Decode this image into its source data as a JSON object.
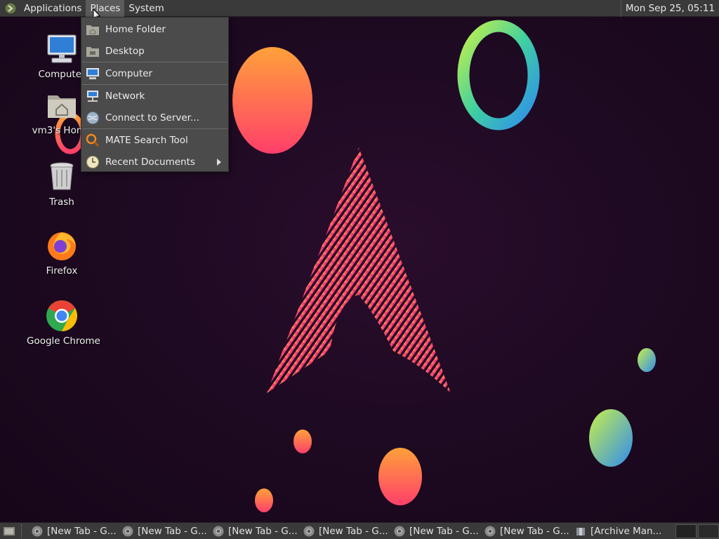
{
  "top_panel": {
    "menus": [
      "Applications",
      "Places",
      "System"
    ],
    "clock": "Mon Sep 25, 05:11"
  },
  "places_menu": {
    "items": [
      {
        "label": "Home Folder",
        "icon": "home-folder-icon"
      },
      {
        "label": "Desktop",
        "icon": "desktop-folder-icon"
      },
      {
        "label": "Computer",
        "icon": "computer-icon"
      },
      {
        "label": "Network",
        "icon": "network-icon"
      },
      {
        "label": "Connect to Server...",
        "icon": "globe-icon"
      },
      {
        "label": "MATE Search Tool",
        "icon": "search-icon"
      },
      {
        "label": "Recent Documents",
        "icon": "clock-icon"
      }
    ]
  },
  "desktop_icons": [
    {
      "label": "Computer",
      "icon": "computer-icon"
    },
    {
      "label": "vm3's Home",
      "icon": "home-folder-icon"
    },
    {
      "label": "Trash",
      "icon": "trash-icon"
    },
    {
      "label": "Firefox",
      "icon": "firefox-icon"
    },
    {
      "label": "Google Chrome",
      "icon": "chrome-icon"
    }
  ],
  "taskbar": {
    "tasks": [
      {
        "label": "[New Tab - G...",
        "icon": "chrome-icon"
      },
      {
        "label": "[New Tab - G...",
        "icon": "chrome-icon"
      },
      {
        "label": "[New Tab - G...",
        "icon": "chrome-icon"
      },
      {
        "label": "[New Tab - G...",
        "icon": "chrome-icon"
      },
      {
        "label": "[New Tab - G...",
        "icon": "chrome-icon"
      },
      {
        "label": "[New Tab - G...",
        "icon": "chrome-icon"
      },
      {
        "label": "[Archive Man...",
        "icon": "archive-manager-icon"
      }
    ]
  },
  "colors": {
    "panel": "#3a3a3a",
    "menu_bg": "#4b4b4b",
    "accent_pink": "#e0206f",
    "accent_orange": "#ff8a30"
  }
}
